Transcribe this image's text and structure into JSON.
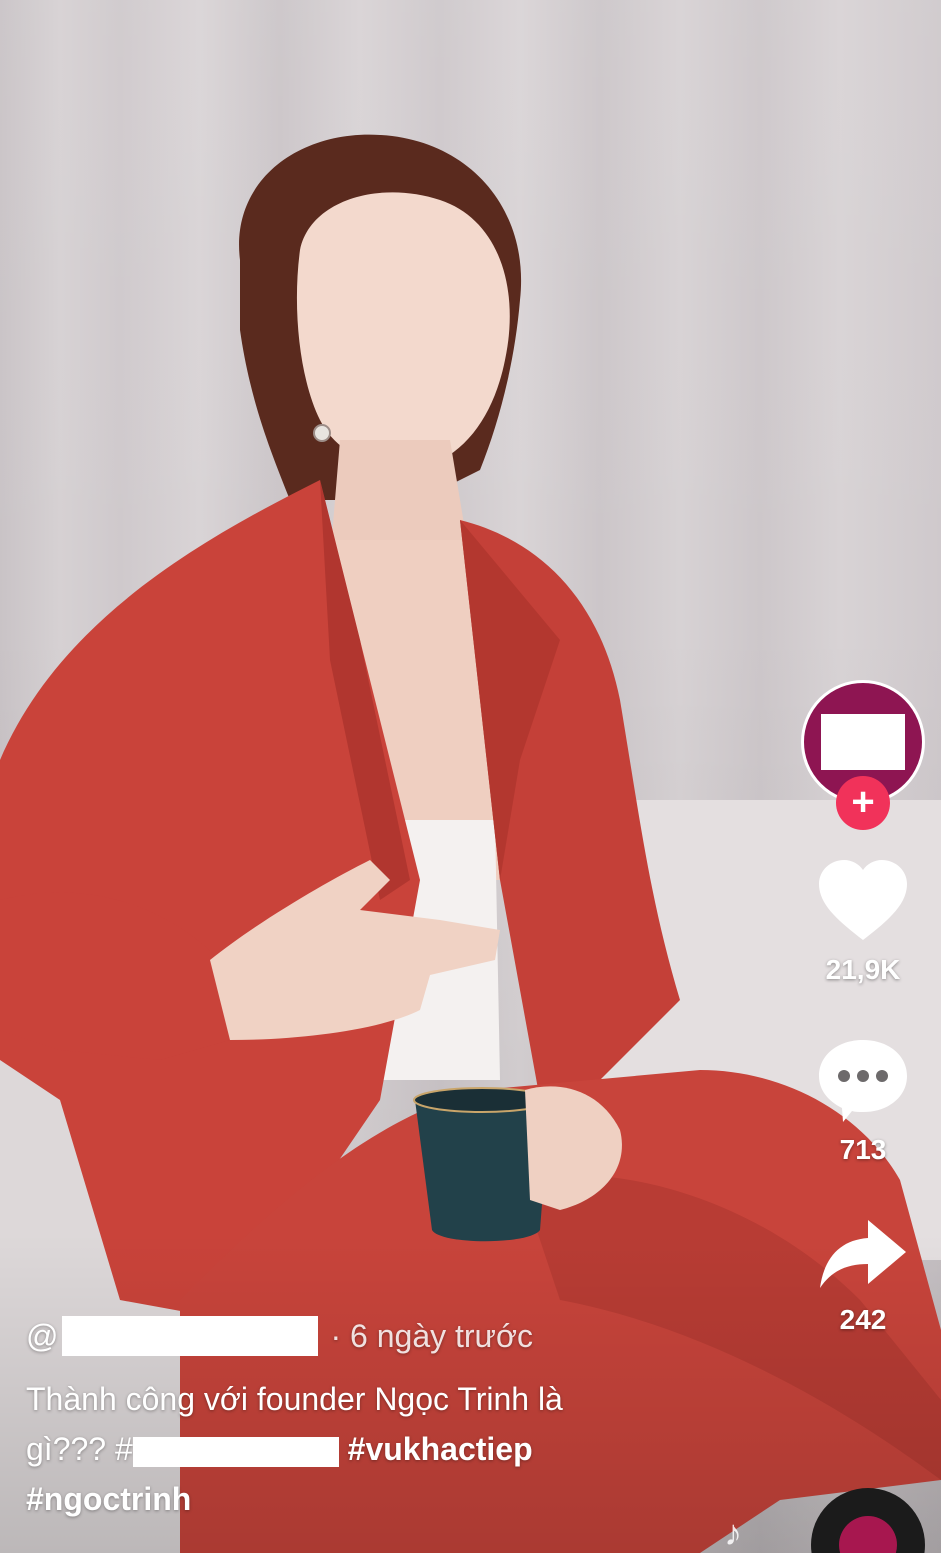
{
  "video": {
    "scene": "video-frame"
  },
  "sidebar": {
    "likes": "21,9K",
    "comments": "713",
    "shares": "242",
    "follow_label": "+",
    "icons": {
      "like": "heart-icon",
      "comment": "comment-bubble-icon",
      "share": "share-arrow-icon",
      "music": "music-note-icon"
    }
  },
  "caption": {
    "at": "@",
    "time": "· 6 ngày trước",
    "desc_line1": "Thành công với founder Ngọc Trinh là",
    "desc_line2_prefix": "gì???  #",
    "tag_vukhactiep": "#vukhactiep",
    "tag_ngoctrinh": "#ngoctrinh"
  },
  "colors": {
    "avatar_bg": "#8e1552",
    "follow_bg": "#f1325a",
    "jacket": "#c9433a"
  }
}
